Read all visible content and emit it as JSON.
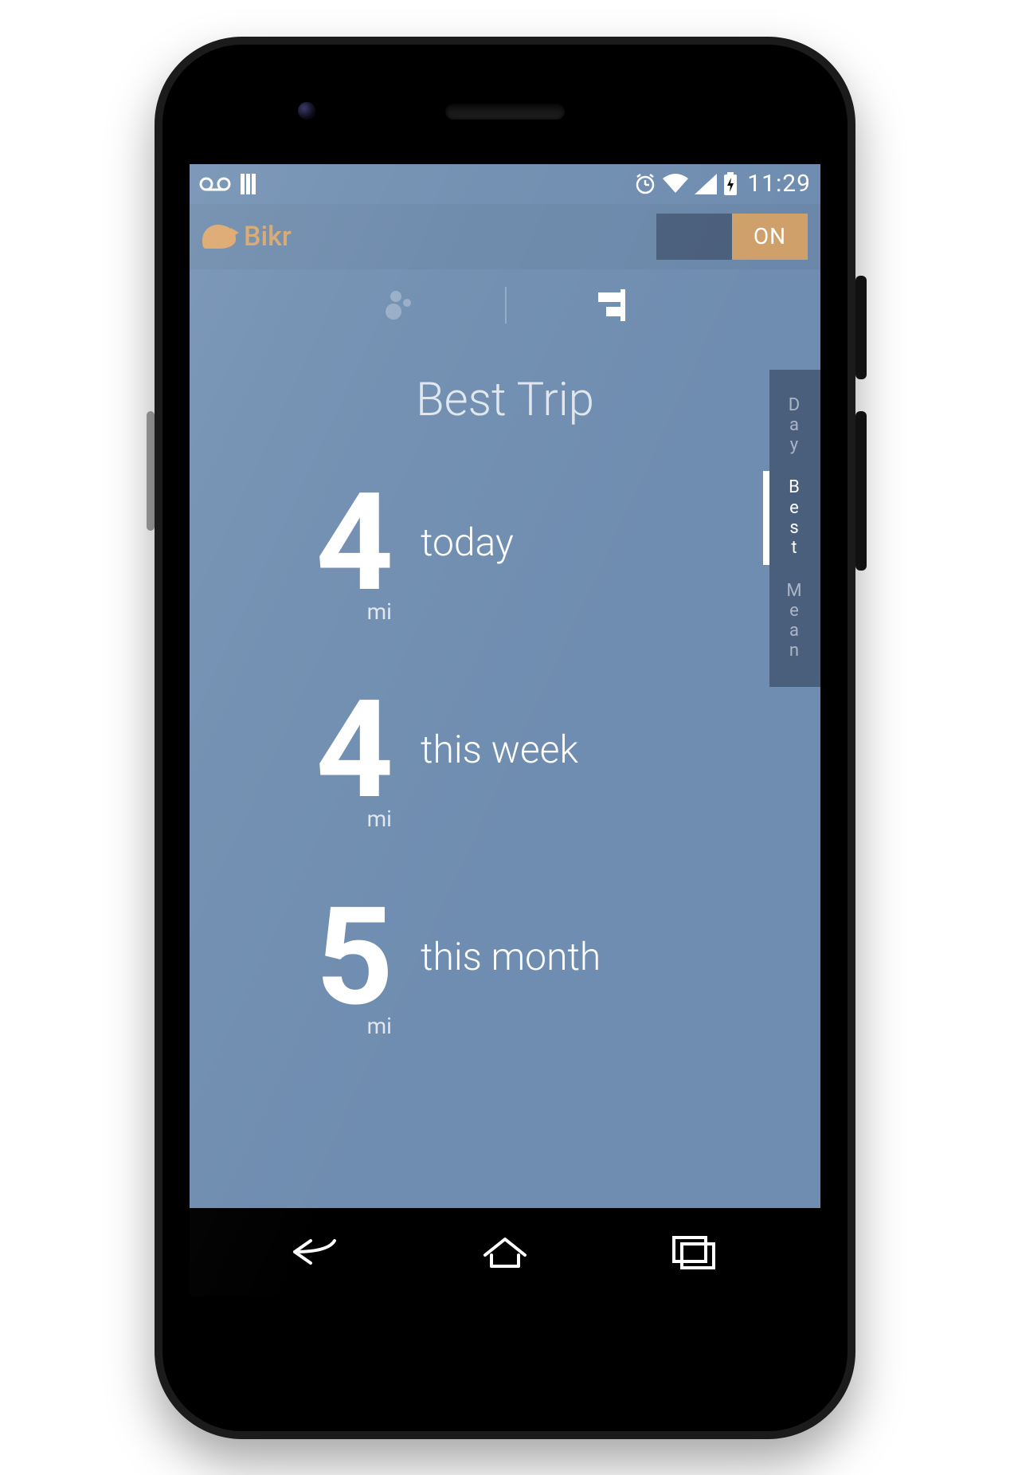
{
  "status": {
    "time": "11:29"
  },
  "app": {
    "title": "Bikr",
    "switch_on_label": "ON"
  },
  "page": {
    "title": "Best Trip"
  },
  "stats": [
    {
      "value": "4",
      "unit": "mi",
      "label": "today"
    },
    {
      "value": "4",
      "unit": "mi",
      "label": "this week"
    },
    {
      "value": "5",
      "unit": "mi",
      "label": "this month"
    }
  ],
  "side_selector": [
    {
      "label": "Day",
      "active": false
    },
    {
      "label": "Best",
      "active": true
    },
    {
      "label": "Mean",
      "active": false
    }
  ]
}
